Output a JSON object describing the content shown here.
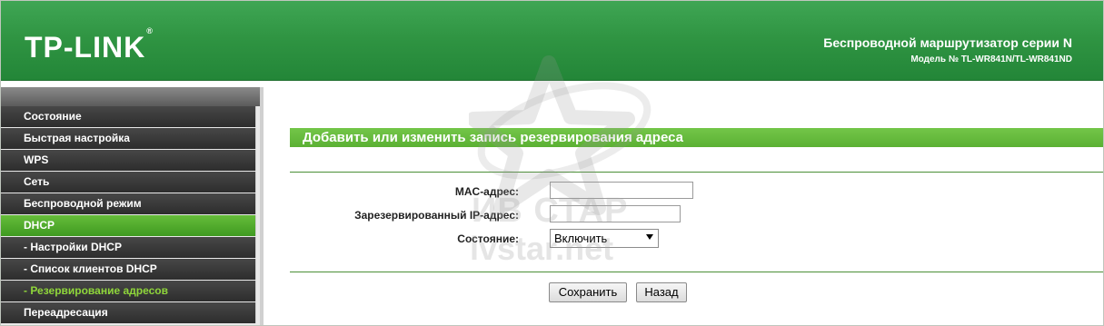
{
  "header": {
    "logo": "TP-LINK",
    "logo_mark": "®",
    "title": "Беспроводной маршрутизатор серии N",
    "model": "Модель № TL-WR841N/TL-WR841ND"
  },
  "sidebar": {
    "items": [
      {
        "label": "Состояние"
      },
      {
        "label": "Быстрая настройка"
      },
      {
        "label": "WPS"
      },
      {
        "label": "Сеть"
      },
      {
        "label": "Беспроводной режим"
      },
      {
        "label": "DHCP"
      },
      {
        "label": "- Настройки DHCP"
      },
      {
        "label": "- Список клиентов DHCP"
      },
      {
        "label": "- Резервирование адресов"
      },
      {
        "label": "Переадресация"
      }
    ]
  },
  "main": {
    "section_title": "Добавить или изменить запись резервирования адреса",
    "mac_label": "MAC-адрес:",
    "mac_value": "",
    "ip_label": "Зарезервированный IP-адрес:",
    "ip_value": "",
    "status_label": "Состояние:",
    "status_value": "Включить",
    "save_label": "Сохранить",
    "back_label": "Назад"
  },
  "watermark": {
    "line1": "ИВ СТАР",
    "line2": "ivstar.net"
  },
  "colors": {
    "header_green": "#2f9442",
    "accent_green": "#5bb134",
    "menu_dark": "#333333",
    "current_item": "#8fd63a"
  }
}
